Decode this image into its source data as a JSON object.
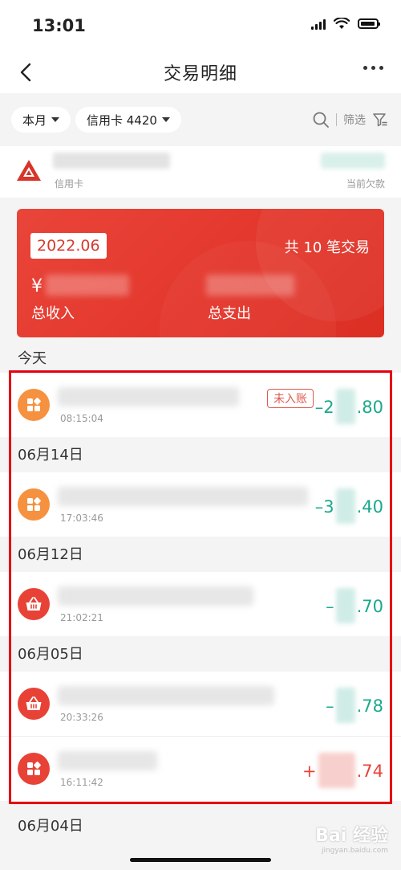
{
  "status_bar": {
    "time": "13:01"
  },
  "nav": {
    "title": "交易明细"
  },
  "filters": {
    "month": "本月",
    "card": "信用卡 4420",
    "filter_label": "筛选"
  },
  "account": {
    "type_label": "信用卡",
    "balance_label": "当前欠款"
  },
  "summary": {
    "month": "2022.06",
    "count_text": "共 10 笔交易",
    "currency": "¥",
    "income_label": "总收入",
    "expense_label": "总支出"
  },
  "groups": [
    {
      "date": "今天",
      "transactions": [
        {
          "time": "08:15:04",
          "badge": "未入账",
          "amount_prefix": "–2",
          "amount_suffix": ".80",
          "direction": "expense",
          "icon": "app-grid-icon"
        }
      ]
    },
    {
      "date": "06月14日",
      "transactions": [
        {
          "time": "17:03:46",
          "amount_prefix": "–3",
          "amount_suffix": ".40",
          "direction": "expense",
          "icon": "app-grid-icon"
        }
      ]
    },
    {
      "date": "06月12日",
      "transactions": [
        {
          "time": "21:02:21",
          "amount_prefix": "–",
          "amount_suffix": ".70",
          "direction": "expense",
          "icon": "shopping-basket-icon"
        }
      ]
    },
    {
      "date": "06月05日",
      "transactions": [
        {
          "time": "20:33:26",
          "amount_prefix": "–",
          "amount_suffix": ".78",
          "direction": "expense",
          "icon": "shopping-basket-icon"
        },
        {
          "time": "16:11:42",
          "amount_prefix": "+",
          "amount_suffix": ".74",
          "direction": "income",
          "icon": "app-grid-icon"
        }
      ]
    },
    {
      "date": "06月04日",
      "transactions": []
    }
  ],
  "watermark": {
    "brand": "Bai 经验",
    "url": "jingyan.baidu.com"
  },
  "colors": {
    "accent_red": "#e84237",
    "expense_green": "#1aa88c",
    "icon_orange": "#f5913f",
    "highlight_red": "#e60012"
  }
}
